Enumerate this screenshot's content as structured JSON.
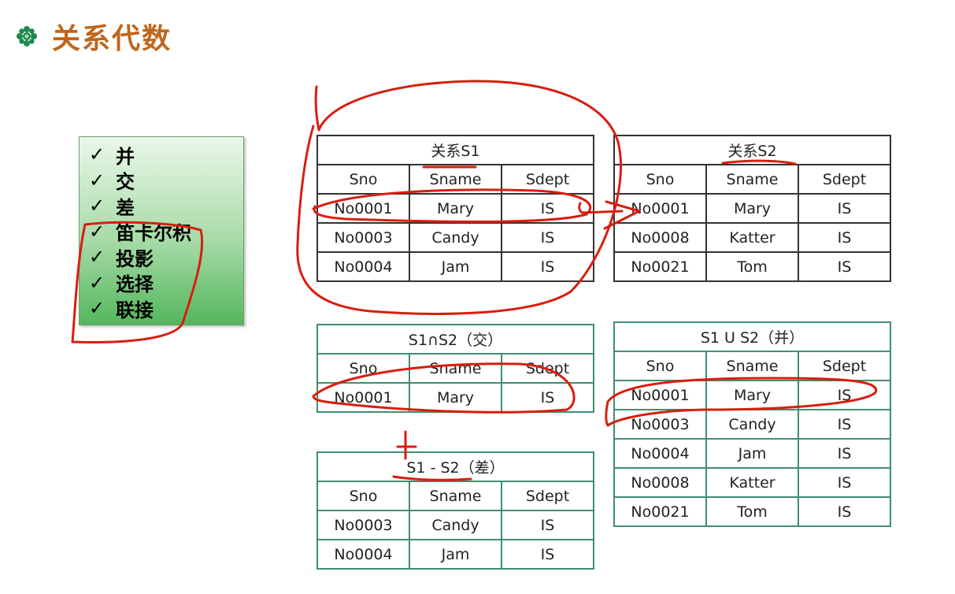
{
  "slide": {
    "title": "关系代数",
    "bullet_icon": "green-flower-bullet-icon"
  },
  "operations": {
    "check": "✓",
    "items": [
      "并",
      "交",
      "差",
      "笛卡尔积",
      "投影",
      "选择",
      "联接"
    ]
  },
  "tables": {
    "s1": {
      "caption": "关系S1",
      "headers": [
        "Sno",
        "Sname",
        "Sdept"
      ],
      "rows": [
        [
          "No0001",
          "Mary",
          "IS"
        ],
        [
          "No0003",
          "Candy",
          "IS"
        ],
        [
          "No0004",
          "Jam",
          "IS"
        ]
      ]
    },
    "s2": {
      "caption": "关系S2",
      "headers": [
        "Sno",
        "Sname",
        "Sdept"
      ],
      "rows": [
        [
          "No0001",
          "Mary",
          "IS"
        ],
        [
          "No0008",
          "Katter",
          "IS"
        ],
        [
          "No0021",
          "Tom",
          "IS"
        ]
      ]
    },
    "intersection": {
      "caption": "S1∩S2（交）",
      "headers": [
        "Sno",
        "Sname",
        "Sdept"
      ],
      "rows": [
        [
          "No0001",
          "Mary",
          "IS"
        ]
      ]
    },
    "difference": {
      "caption": "S1 - S2（差）",
      "headers": [
        "Sno",
        "Sname",
        "Sdept"
      ],
      "rows": [
        [
          "No0003",
          "Candy",
          "IS"
        ],
        [
          "No0004",
          "Jam",
          "IS"
        ]
      ]
    },
    "union": {
      "caption": "S1 U S2（并）",
      "headers": [
        "Sno",
        "Sname",
        "Sdept"
      ],
      "rows": [
        [
          "No0001",
          "Mary",
          "IS"
        ],
        [
          "No0003",
          "Candy",
          "IS"
        ],
        [
          "No0004",
          "Jam",
          "IS"
        ],
        [
          "No0008",
          "Katter",
          "IS"
        ],
        [
          "No0021",
          "Tom",
          "IS"
        ]
      ]
    }
  },
  "annotation_color": "#d81e10"
}
